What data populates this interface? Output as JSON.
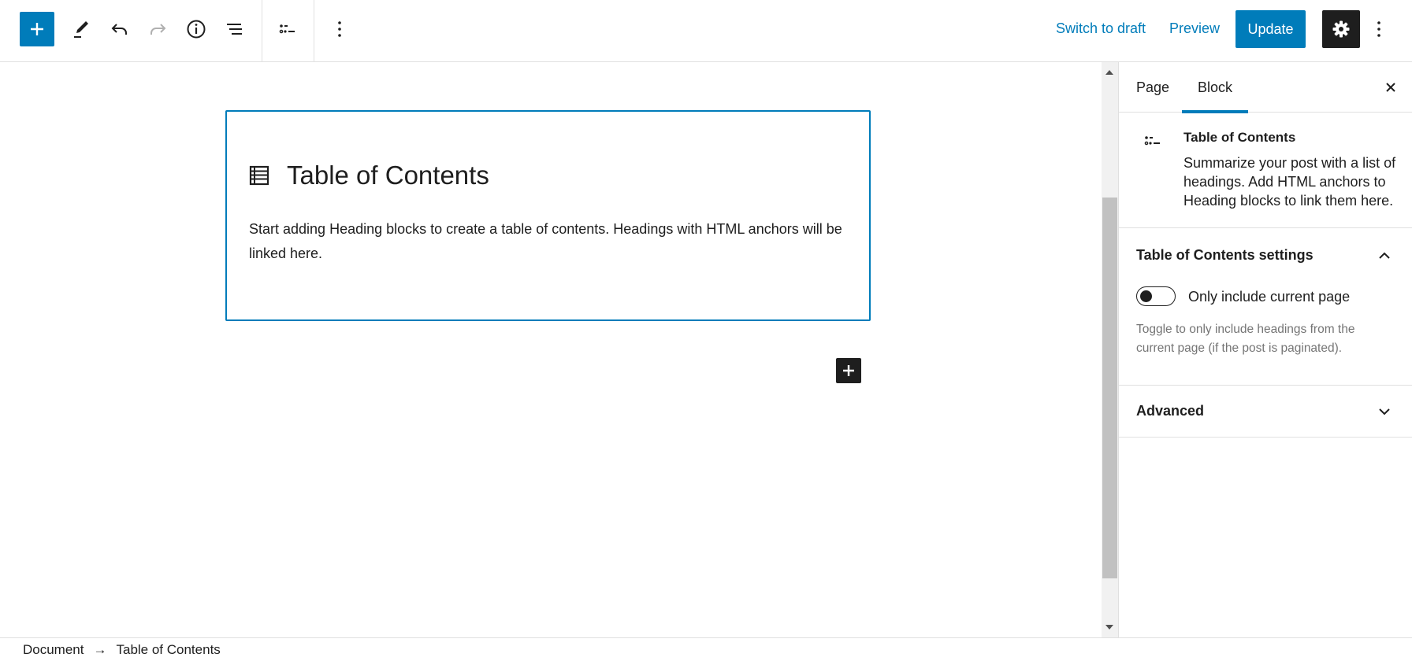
{
  "toolbar": {
    "switch_to_draft": "Switch to draft",
    "preview": "Preview",
    "update": "Update"
  },
  "editor": {
    "block_title": "Table of Contents",
    "block_description": "Start adding Heading blocks to create a table of contents. Headings with HTML anchors will be linked here."
  },
  "sidebar": {
    "tabs": [
      {
        "label": "Page",
        "active": false
      },
      {
        "label": "Block",
        "active": true
      }
    ],
    "block_card": {
      "title": "Table of Contents",
      "description": "Summarize your post with a list of headings. Add HTML anchors to Heading blocks to link them here."
    },
    "settings_panel": {
      "title": "Table of Contents settings",
      "expanded": true,
      "toggle_label": "Only include current page",
      "toggle_checked": false,
      "help": "Toggle to only include headings from the current page (if the post is paginated)."
    },
    "advanced_panel": {
      "title": "Advanced",
      "expanded": false
    }
  },
  "breadcrumb": {
    "items": [
      "Document",
      "Table of Contents"
    ],
    "separator": "→"
  },
  "colors": {
    "accent": "#007cba",
    "dark": "#1e1e1e",
    "muted": "#757575"
  }
}
